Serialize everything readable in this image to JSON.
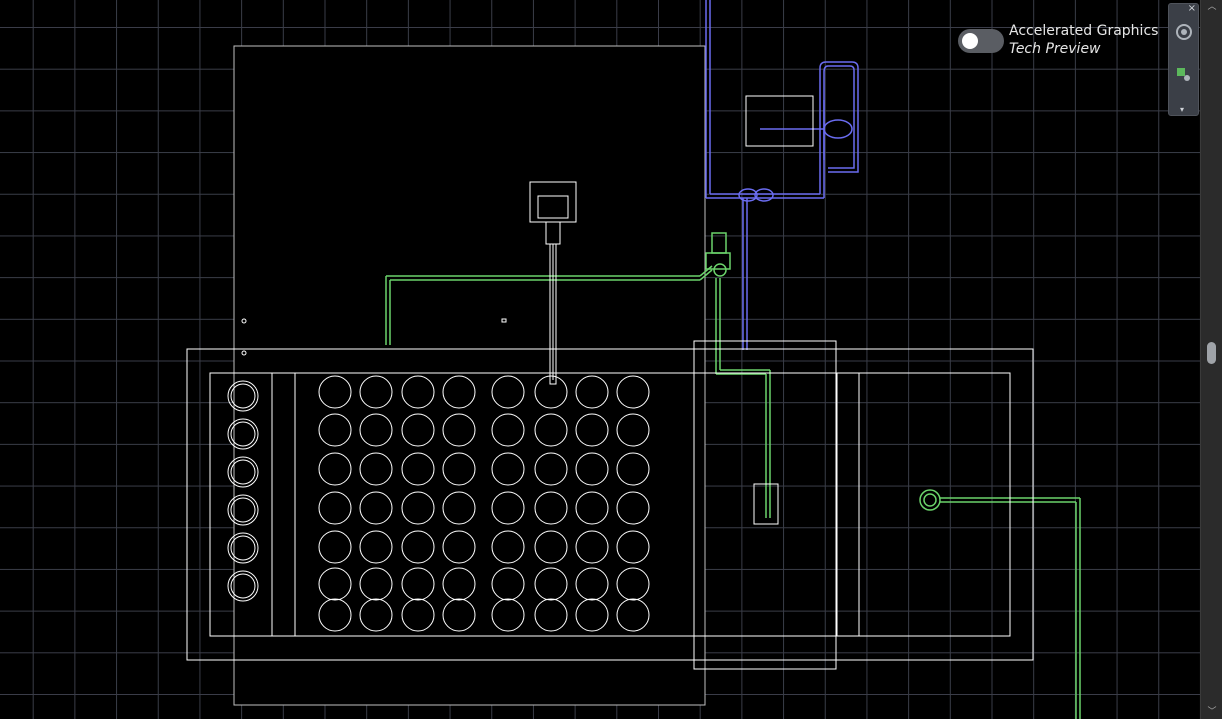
{
  "toggle": {
    "title": "Accelerated Graphics",
    "subtitle": "Tech Preview",
    "enabled": false
  },
  "navbar": {
    "close_glyph": "×",
    "menu_glyph": "▾",
    "icons": [
      "orbit-icon",
      "pan-icon"
    ]
  },
  "scrollbar": {
    "up_glyph": "︿",
    "down_glyph": "﹀",
    "position": 0.49
  },
  "colors": {
    "background": "#000000",
    "grid": "#3a3d48",
    "geometry_white": "#ffffff",
    "pipe_green": "#6bd36b",
    "pipe_blue": "#6a6cf0"
  }
}
